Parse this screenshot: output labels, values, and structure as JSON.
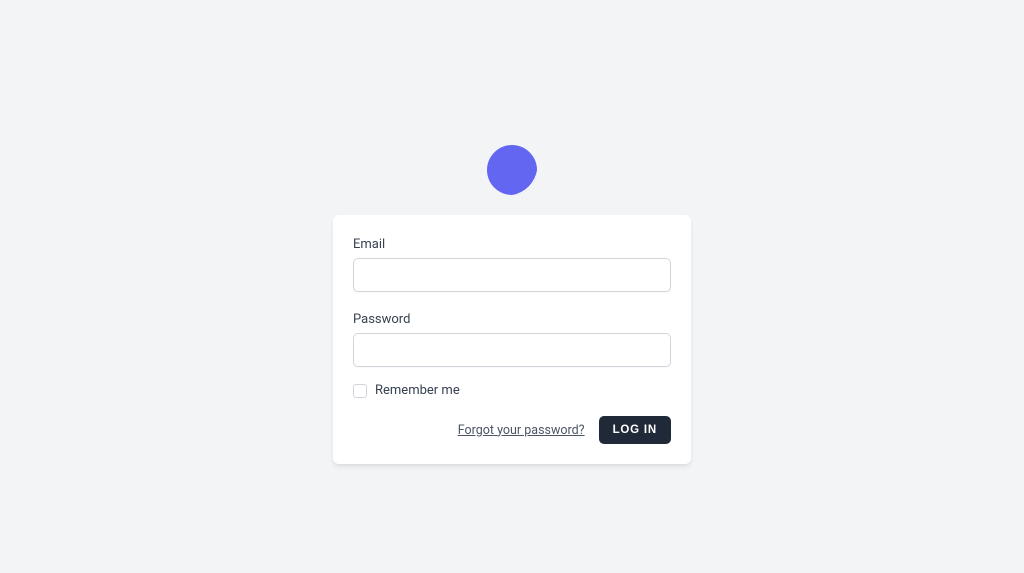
{
  "form": {
    "email_label": "Email",
    "password_label": "Password",
    "remember_label": "Remember me",
    "forgot_link": "Forgot your password?",
    "login_button": "LOG IN"
  },
  "colors": {
    "brand": "#6366f1",
    "button_bg": "#1f2937",
    "page_bg": "#f3f4f6"
  }
}
